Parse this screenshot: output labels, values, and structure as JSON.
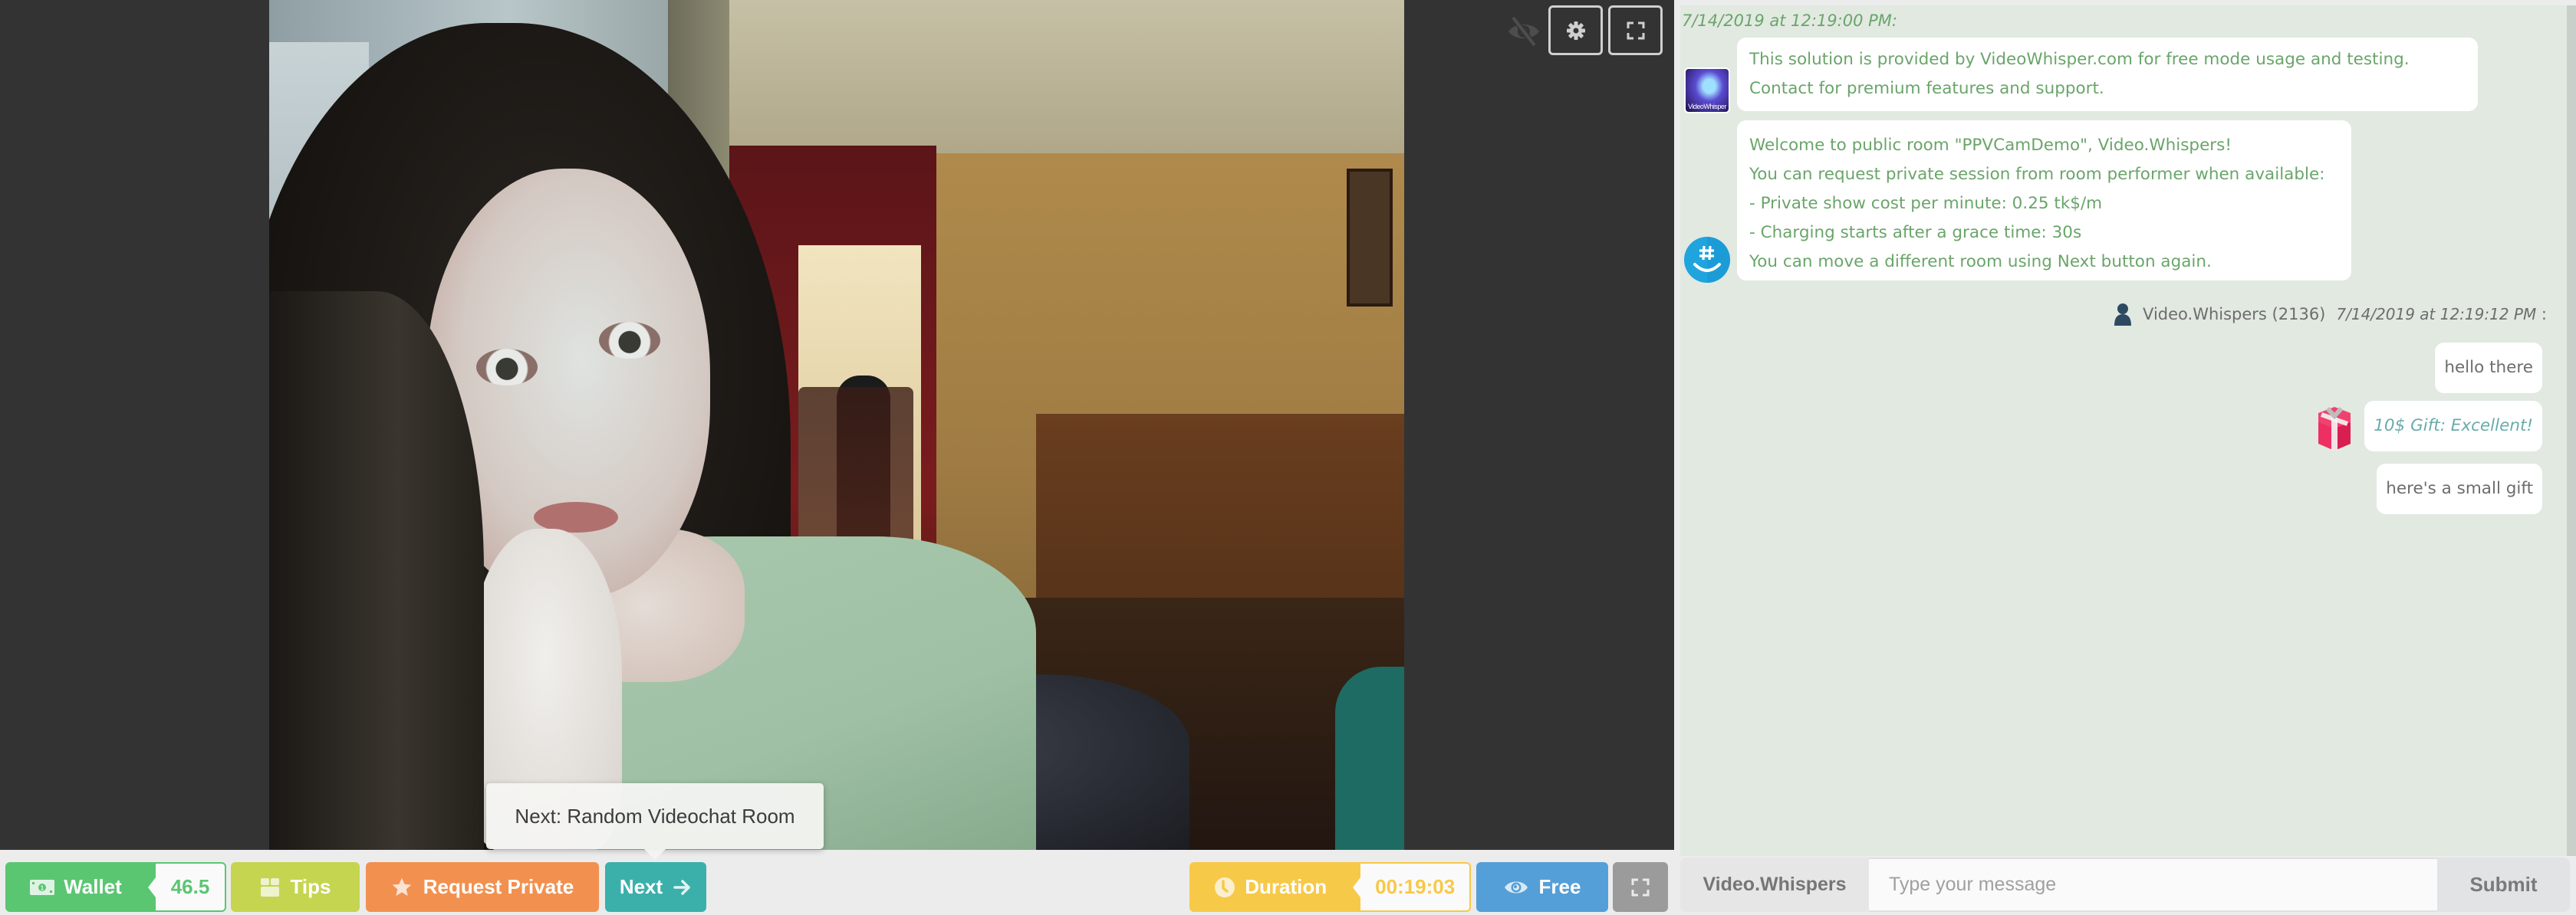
{
  "video": {
    "controls": {
      "hide_video_icon": "eye-slash-icon",
      "settings_icon": "gear-icon",
      "fullscreen_icon": "expand-icon"
    },
    "tooltip": "Next: Random Videochat Room"
  },
  "toolbar": {
    "wallet": {
      "label": "Wallet",
      "value": "46.5",
      "icon": "money-bill-icon",
      "color": "#5ac672"
    },
    "tips": {
      "label": "Tips",
      "icon": "gift-box-icon",
      "color": "#c5d550"
    },
    "request_private": {
      "label": "Request Private",
      "icon": "star-icon",
      "color": "#f2914f"
    },
    "next": {
      "label": "Next",
      "icon": "arrow-right-icon",
      "color": "#3bb0ab"
    },
    "duration": {
      "label": "Duration",
      "value": "00:19:03",
      "icon": "clock-icon",
      "color": "#f7c948"
    },
    "free": {
      "label": "Free",
      "icon": "eye-icon",
      "color": "#559fd8"
    },
    "fullscreen": {
      "icon": "expand-icon",
      "color": "#9b9b9b"
    }
  },
  "chat": {
    "system_timestamp": "7/14/2019 at 12:19:00 PM:",
    "system_messages": [
      {
        "avatar": "videowhisper-logo",
        "avatar_label": "VideoWhisper",
        "lines": [
          "This solution is provided by VideoWhisper.com for free mode usage and testing.",
          "Contact for premium features and support."
        ]
      },
      {
        "avatar": "hashtag-smile-icon",
        "lines": [
          "Welcome to public room \"PPVCamDemo\", Video.Whispers!",
          "You can request private session from room performer when available:",
          "- Private show cost per minute: 0.25 tk$/m",
          "- Charging starts after a grace time: 30s",
          "You can move a different room using Next button again."
        ]
      }
    ],
    "user_block": {
      "sender": "Video.Whispers (2136)",
      "timestamp": "7/14/2019 at 12:19:12 PM",
      "separator": ":",
      "messages": [
        {
          "text": "hello there",
          "type": "text"
        },
        {
          "text": "10$ Gift: Excellent!",
          "type": "gift",
          "icon": "gift-icon"
        },
        {
          "text": "here's a small gift",
          "type": "text"
        }
      ]
    },
    "input": {
      "username": "Video.Whispers",
      "placeholder": "Type your message",
      "value": "",
      "submit_label": "Submit"
    }
  }
}
